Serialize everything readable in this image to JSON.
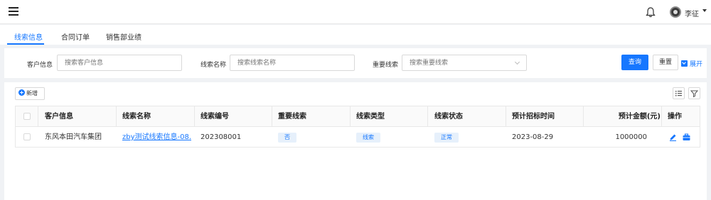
{
  "header": {
    "user_name": "李征",
    "icons": [
      "menu-icon",
      "bell-icon",
      "avatar",
      "caret-down-icon"
    ]
  },
  "tabs": [
    {
      "label": "线索信息",
      "active": true
    },
    {
      "label": "合同订单",
      "active": false
    },
    {
      "label": "销售部业绩",
      "active": false
    }
  ],
  "search": {
    "customer_label": "客户信息",
    "customer_placeholder": "搜索客户信息",
    "lead_name_label": "线索名称",
    "lead_name_placeholder": "搜索线索名称",
    "important_label": "重要线索",
    "important_placeholder": "搜索重要线索",
    "query_button": "查询",
    "reset_button": "重置",
    "expand_button": "展开"
  },
  "toolbar": {
    "add_button": "新增",
    "icons": [
      "add-icon",
      "column-settings-icon",
      "filter-icon"
    ]
  },
  "table": {
    "columns": [
      "客户信息",
      "线索名称",
      "线索编号",
      "重要线索",
      "线索类型",
      "线索状态",
      "预计招标时间",
      "预计金额(元)",
      "操作"
    ],
    "rows": [
      {
        "customer": "东风本田汽车集团",
        "lead_name": "zby测试线索信息-08...",
        "lead_no": "202308001",
        "important": "否",
        "lead_type": "线索",
        "status": "正常",
        "bid_time": "2023-08-29",
        "amount": "1000000",
        "actions": [
          "edit-icon",
          "briefcase-icon"
        ]
      }
    ]
  },
  "colors": {
    "primary": "#1677ff",
    "tag_bg": "#e6f0fb",
    "page_bg": "#f0f2f5"
  }
}
